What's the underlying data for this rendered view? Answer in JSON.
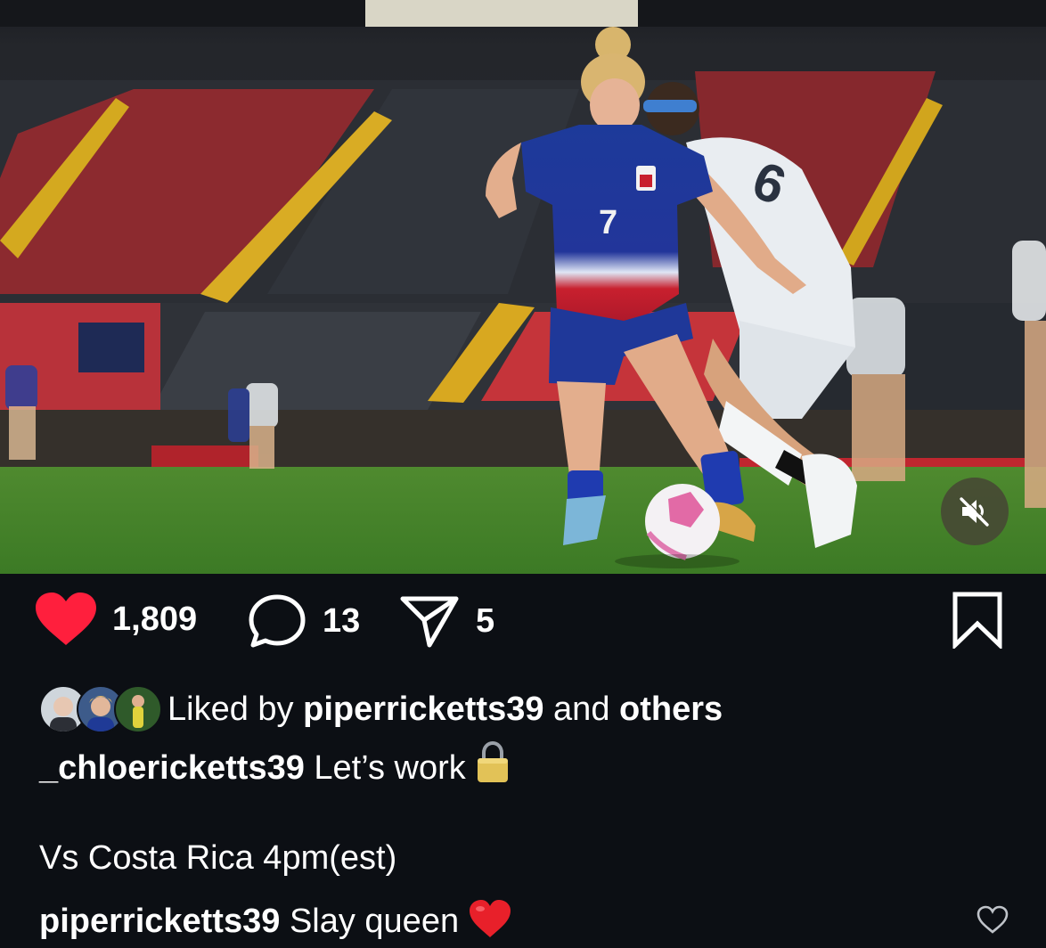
{
  "post": {
    "likes": "1,809",
    "comments": "13",
    "shares": "5"
  },
  "liked_by": {
    "prefix": "Liked by",
    "user": "piperricketts39",
    "and": "and",
    "others": "others"
  },
  "caption": {
    "username": "_chloericketts39",
    "text": "Let’s work",
    "line2": "Vs Costa Rica 4pm(est)"
  },
  "comment": {
    "username": "piperricketts39",
    "text": "Slay queen"
  },
  "icons": {
    "mute": "speaker-muted-icon",
    "like": "heart-icon",
    "comment": "speech-bubble-icon",
    "share": "paper-plane-icon",
    "save": "bookmark-icon"
  },
  "colors": {
    "like_active": "#ff1f3d",
    "background": "#0c0f14",
    "text": "#ffffff"
  }
}
